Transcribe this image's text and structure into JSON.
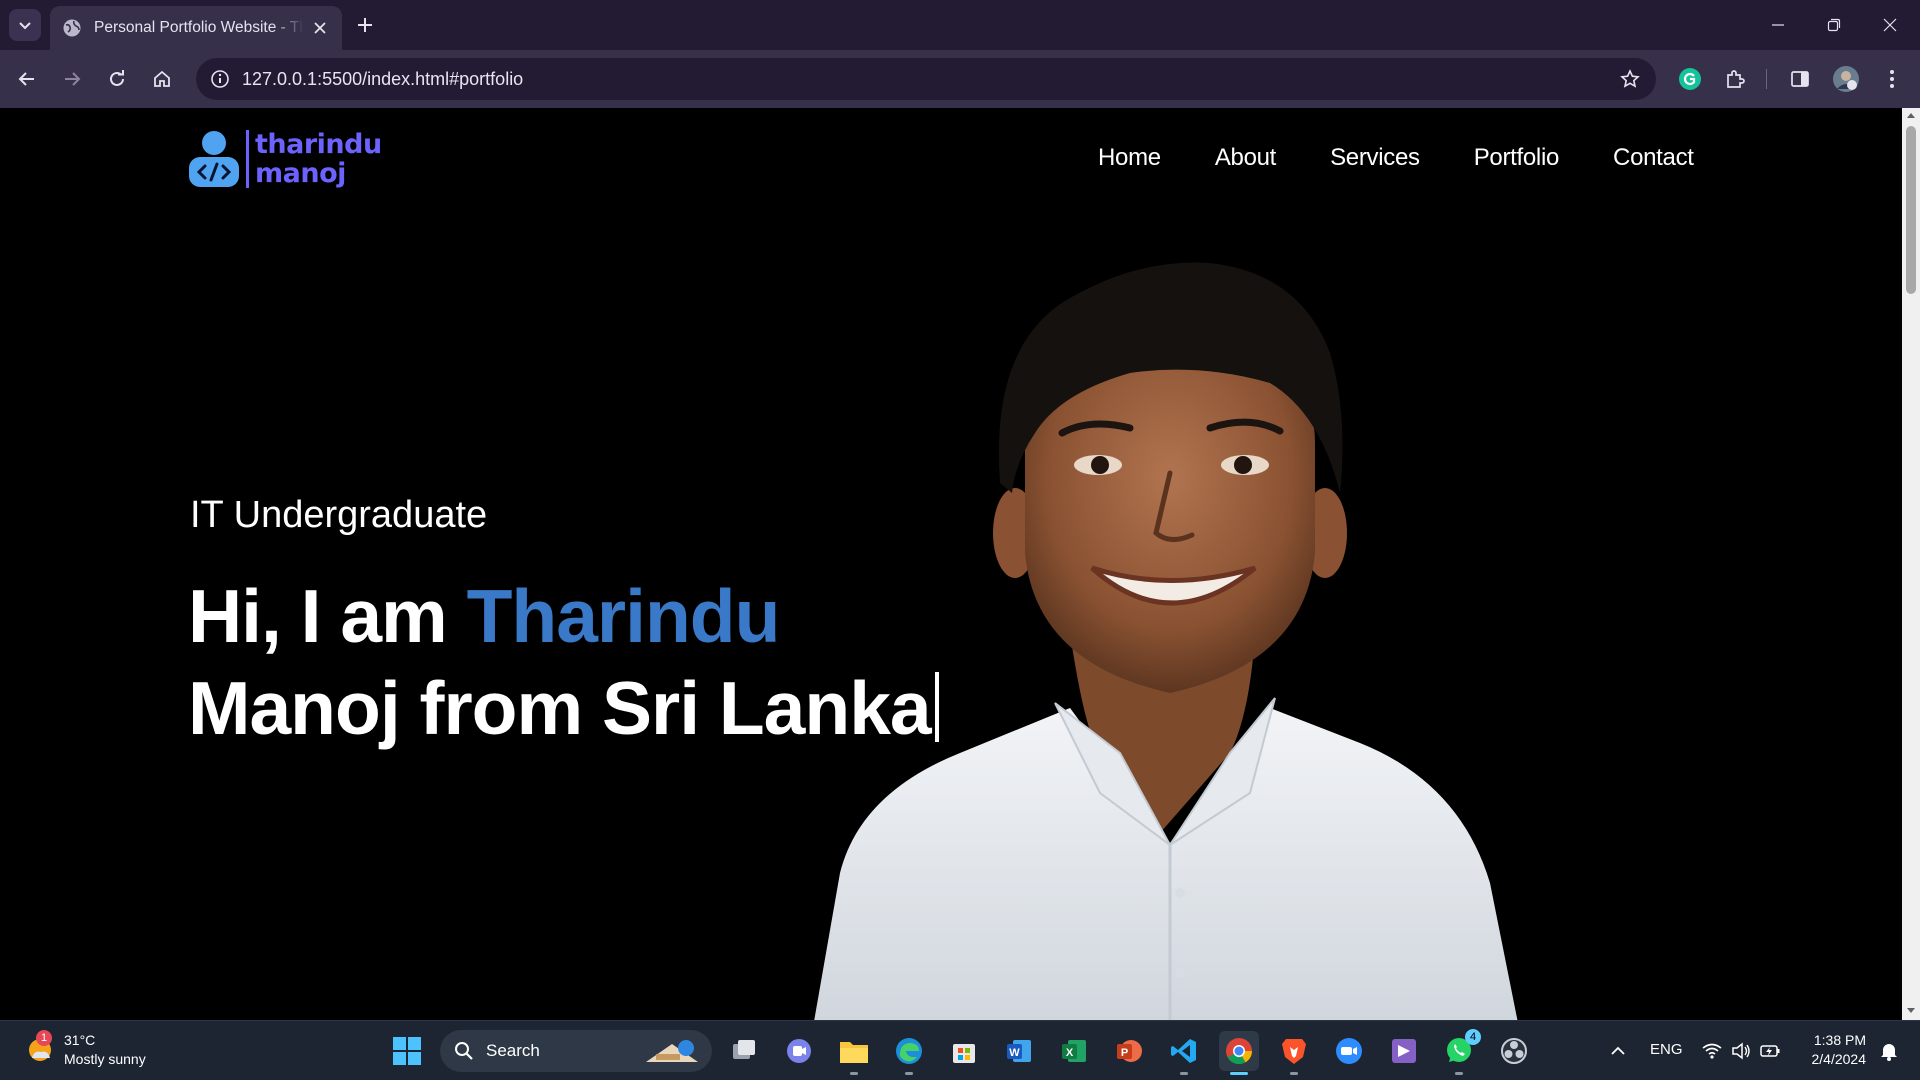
{
  "browser": {
    "tab_title": "Personal Portfolio Website - Tharindu Manoj",
    "url": "127.0.0.1:5500/index.html#portfolio"
  },
  "site": {
    "logo_line1": "tharindu",
    "logo_line2": "manoj",
    "nav": [
      "Home",
      "About",
      "Services",
      "Portfolio",
      "Contact"
    ],
    "subtitle": "IT Undergraduate",
    "headline_prefix": "Hi, I am ",
    "headline_name": "Tharindu",
    "headline_rest": "Manoj from Sri Lanka",
    "accent_color": "#3a79c8",
    "logo_color": "#6c63ff"
  },
  "taskbar": {
    "weather_temp": "31°C",
    "weather_desc": "Mostly sunny",
    "weather_badge": "1",
    "search_label": "Search",
    "whatsapp_badge": "4",
    "language": "ENG",
    "time": "1:38 PM",
    "date": "2/4/2024"
  }
}
